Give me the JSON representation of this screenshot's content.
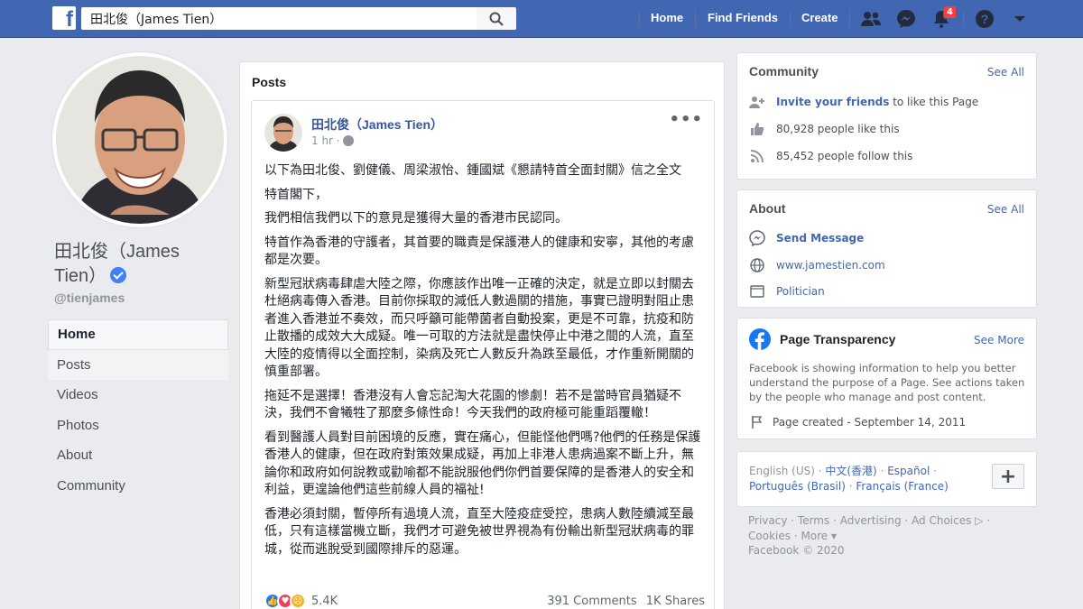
{
  "topbar": {
    "search_value": "田北俊（James Tien）",
    "nav": [
      "Home",
      "Find Friends",
      "Create"
    ],
    "notification_count": "4",
    "icons": [
      "friends-icon",
      "messenger-icon",
      "notifications-icon",
      "help-icon",
      "account-menu-icon"
    ]
  },
  "page": {
    "name_line1": "田北俊（James",
    "name_line2": "Tien）",
    "handle": "@tienjames",
    "nav": [
      "Home",
      "Posts",
      "Videos",
      "Photos",
      "About",
      "Community"
    ]
  },
  "posts": {
    "title": "Posts",
    "author": "田北俊（James Tien）",
    "time": "1 hr ·",
    "paragraphs": [
      "以下為田北俊、劉健儀、周梁淑怡、鍾國斌《懇請特首全面封關》信之全文",
      "特首閣下，",
      "我們相信我們以下的意見是獲得大量的香港市民認同。",
      "特首作為香港的守護者，其首要的職責是保護港人的健康和安寧，其他的考慮都是次要。",
      "新型冠狀病毒肆虐大陸之際，你應該作出唯一正確的決定，就是立即以封關去杜絕病毒傳入香港。目前你採取的減低人數過關的措施，事實已證明對阻止患者進入香港並不奏效，而只呼籲可能帶菌者自動投案，更是不可靠，抗疫和防止散播的成效大大成疑。唯一可取的方法就是盡快停止中港之間的人流，直至大陸的疫情得以全面控制，染病及死亡人數反升為跌至最低，才作重新開關的慎重部署。",
      "拖延不是選擇！香港沒有人會忘記淘大花園的慘劇！若不是當時官員猶疑不決，我們不會犧牲了那麼多條性命！今天我們的政府極可能重蹈覆轍！",
      "看到醫護人員對目前困境的反應，實在痛心，但能怪他們嗎?他們的任務是保護香港人的健康，但在政府對策效果成疑，再加上非港人患病過案不斷上升，無論你和政府如何說教或勸喻都不能說服他們你們首要保障的是香港人的安全和利益，更遑論他們這些前線人員的福祉!",
      "香港必須封關，暫停所有過境人流，直至大陸疫症受控，患病人數陸續減至最低，只有這樣當機立斷，我們才可避免被世界視為有份輸出新型冠狀病毒的罪城，從而逃脫受到國際排斥的惡運。"
    ],
    "reaction_count": "5.4K",
    "comments": "391 Comments",
    "shares": "1K Shares"
  },
  "community": {
    "title": "Community",
    "see_all": "See All",
    "invite_link": "Invite your friends",
    "invite_rest": " to like this Page",
    "likes": "80,928 people like this",
    "follows": "85,452 people follow this"
  },
  "about": {
    "title": "About",
    "see_all": "See All",
    "send_message": "Send Message",
    "website": "www.jamestien.com",
    "category": "Politician"
  },
  "transparency": {
    "title": "Page Transparency",
    "see_more": "See More",
    "text": "Facebook is showing information to help you better understand the purpose of a Page. See actions taken by the people who manage and post content.",
    "created": "Page created - September 14, 2011"
  },
  "languages": {
    "current": "English (US)",
    "others": [
      "中文(香港)",
      "Español",
      "Português (Brasil)",
      "Français (France)"
    ]
  },
  "legal": {
    "links": [
      "Privacy",
      "Terms",
      "Advertising",
      "Ad Choices",
      "Cookies",
      "More"
    ],
    "copyright": "Facebook © 2020"
  },
  "colors": {
    "brand_blue": "#4267b2",
    "link_blue": "#365899",
    "background": "#e9ebee",
    "badge_red": "#fa3e3e"
  }
}
